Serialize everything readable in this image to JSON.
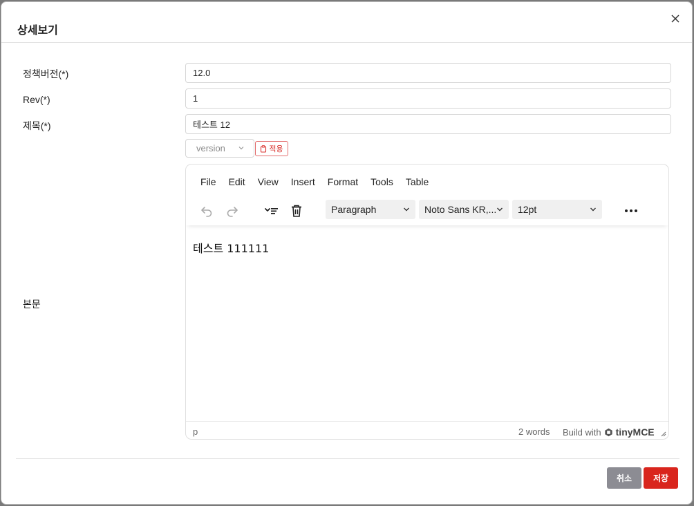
{
  "modal": {
    "title": "상세보기"
  },
  "fields": {
    "policy_version": {
      "label": "정책버전(*)",
      "value": "12.0"
    },
    "rev": {
      "label": "Rev(*)",
      "value": "1"
    },
    "subject": {
      "label": "제목(*)",
      "value": "테스트 12"
    },
    "body": {
      "label": "본문"
    }
  },
  "version_select": {
    "placeholder": "version"
  },
  "apply_button": {
    "label": "적용"
  },
  "editor": {
    "menu": [
      "File",
      "Edit",
      "View",
      "Insert",
      "Format",
      "Tools",
      "Table"
    ],
    "block_format": "Paragraph",
    "font_family": "Noto Sans KR,...",
    "font_size": "12pt",
    "content": "테스트 111111",
    "status_path": "p",
    "word_count": "2 words",
    "branding_prefix": "Build with",
    "branding_name": "tinyMCE"
  },
  "footer": {
    "cancel_label": "취소",
    "save_label": "저장"
  },
  "colors": {
    "save_button": "#d9251d",
    "cancel_button": "#8c8c93",
    "apply_accent": "#d9302c"
  },
  "icons": [
    "close-icon",
    "chevron-down-icon",
    "clipboard-icon",
    "undo-icon",
    "redo-icon",
    "align-format-icon",
    "trash-icon",
    "more-icon",
    "tinymce-logo-icon",
    "resize-handle-icon"
  ]
}
